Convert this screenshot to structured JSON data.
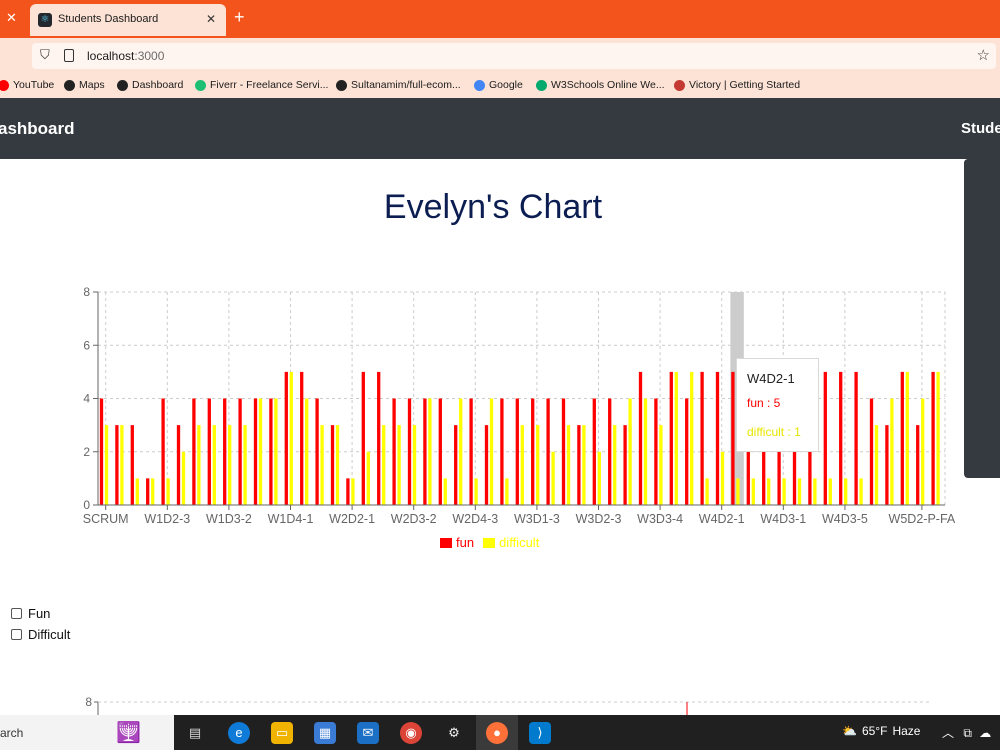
{
  "browser": {
    "tab_title": "Students Dashboard",
    "url_host": "localhost",
    "url_port": ":3000",
    "bookmarks": [
      {
        "label": "YouTube",
        "icon": "youtube-icon",
        "color": "#ff0000"
      },
      {
        "label": "Maps",
        "icon": "globe-icon",
        "color": "#222222"
      },
      {
        "label": "Dashboard",
        "icon": "globe-icon",
        "color": "#222222"
      },
      {
        "label": "Fiverr - Freelance Servi...",
        "icon": "fiverr-icon",
        "color": "#1dbf73"
      },
      {
        "label": "Sultanamim/full-ecom...",
        "icon": "github-icon",
        "color": "#222222"
      },
      {
        "label": "Google",
        "icon": "google-icon",
        "color": "#4285f4"
      },
      {
        "label": "W3Schools Online We...",
        "icon": "w3schools-icon",
        "color": "#04aa6d"
      },
      {
        "label": "Victory | Getting Started",
        "icon": "victory-icon",
        "color": "#c43a31"
      }
    ]
  },
  "navbar": {
    "brand": "ashboard",
    "right_link": "Stude"
  },
  "chart_title": "Evelyn's Chart",
  "chart_data": {
    "type": "bar",
    "ylim": [
      0,
      8
    ],
    "yticks": [
      0,
      2,
      4,
      6,
      8
    ],
    "grid": true,
    "legend_placement": "bottom-center",
    "tick_labels": [
      "SCRUM",
      "W1D2-3",
      "W1D3-2",
      "W1D4-1",
      "W2D2-1",
      "W2D3-2",
      "W2D4-3",
      "W3D1-3",
      "W3D2-3",
      "W3D3-4",
      "W4D2-1",
      "W4D3-1",
      "W4D3-5",
      "W5D2-P-FA"
    ],
    "tick_positions": [
      0,
      4,
      8,
      12,
      16,
      20,
      24,
      28,
      32,
      36,
      40,
      44,
      48,
      53
    ],
    "highlight_index": 41,
    "series": [
      {
        "name": "fun",
        "color": "#ff0000",
        "values": [
          4,
          3,
          3,
          1,
          4,
          3,
          4,
          4,
          4,
          4,
          4,
          4,
          5,
          5,
          4,
          3,
          1,
          5,
          5,
          4,
          4,
          4,
          4,
          3,
          4,
          3,
          4,
          4,
          4,
          4,
          4,
          3,
          4,
          4,
          3,
          5,
          4,
          5,
          4,
          5,
          5,
          5,
          5,
          4,
          4,
          4,
          4,
          5,
          5,
          5,
          4,
          3,
          5,
          3,
          5
        ]
      },
      {
        "name": "difficult",
        "color": "#ffff00",
        "values": [
          3,
          3,
          1,
          1,
          1,
          2,
          3,
          3,
          3,
          3,
          4,
          4,
          5,
          4,
          3,
          3,
          1,
          2,
          3,
          3,
          3,
          4,
          1,
          4,
          1,
          4,
          1,
          3,
          3,
          2,
          3,
          3,
          2,
          3,
          4,
          4,
          3,
          5,
          5,
          1,
          2,
          1,
          1,
          1,
          1,
          1,
          1,
          1,
          1,
          1,
          3,
          4,
          5,
          4,
          5
        ]
      }
    ]
  },
  "tooltip": {
    "label": "W4D2-1",
    "fun_text": "fun : 5",
    "difficult_text": "difficult : 1"
  },
  "filters": [
    {
      "label": "Fun",
      "checked": false
    },
    {
      "label": "Difficult",
      "checked": false
    }
  ],
  "chart2_partial": {
    "ytick_top": "8"
  },
  "taskbar": {
    "search_text": "arch",
    "weather_temp": "65°F",
    "weather_desc": "Haze"
  }
}
